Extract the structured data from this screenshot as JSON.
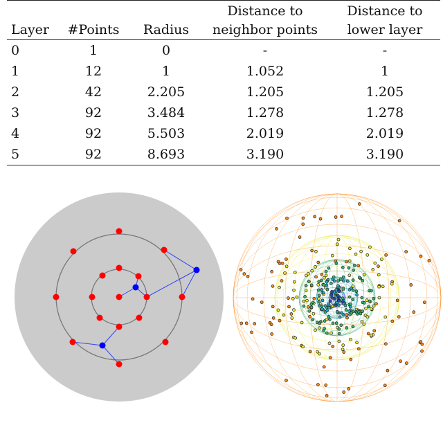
{
  "table": {
    "headers": [
      "Layer",
      "#Points",
      "Radius",
      "Distance to neighbor points",
      "Distance to lower layer"
    ],
    "header_lines": [
      [
        "",
        "",
        "",
        "Distance to",
        "Distance to"
      ],
      [
        "Layer",
        "#Points",
        "Radius",
        "neighbor points",
        "lower layer"
      ]
    ],
    "rows": [
      [
        "0",
        "1",
        "0",
        "-",
        "-"
      ],
      [
        "1",
        "12",
        "1",
        "1.052",
        "1"
      ],
      [
        "2",
        "42",
        "2.205",
        "1.205",
        "1.205"
      ],
      [
        "3",
        "92",
        "3.484",
        "1.278",
        "1.278"
      ],
      [
        "4",
        "92",
        "5.503",
        "2.019",
        "2.019"
      ],
      [
        "5",
        "92",
        "8.693",
        "3.190",
        "3.190"
      ]
    ]
  },
  "figure": {
    "left_diagram": {
      "background": "#cbcbcb",
      "ring_color": "#777777",
      "point_color": "#ff0000",
      "query_color": "#0000ff",
      "edge_color": "#3344ee"
    },
    "right_diagram": {
      "layer_colors": [
        "#1f4fbf",
        "#27a8c8",
        "#3cb371",
        "#e8e832",
        "#ff8c1a"
      ]
    }
  }
}
